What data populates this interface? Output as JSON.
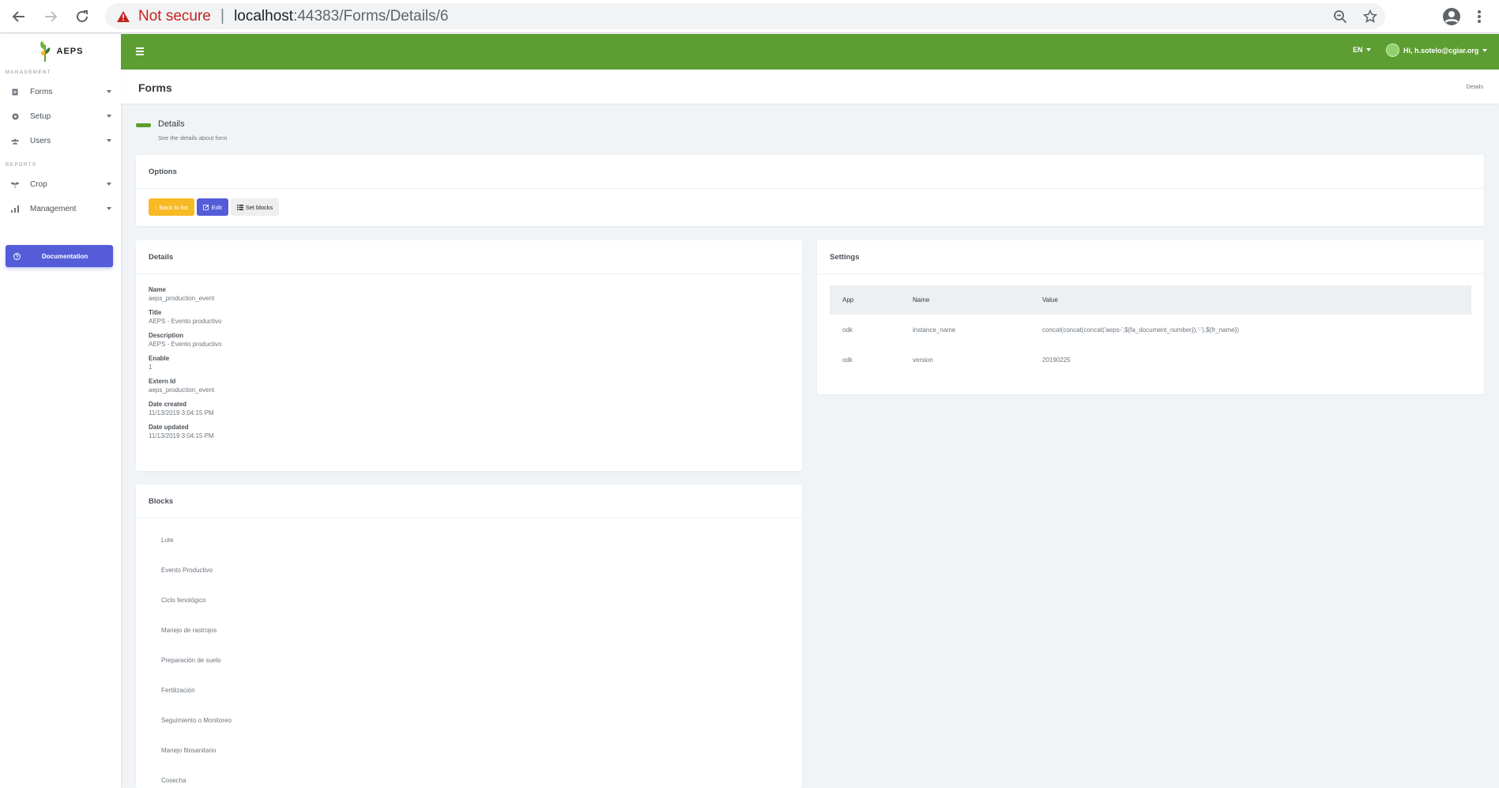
{
  "browser": {
    "security_label": "Not secure",
    "url_host": "localhost",
    "url_path": ":44383/Forms/Details/6"
  },
  "sidebar": {
    "logo_text": "AEPS",
    "management_title": "MANAGEMENT",
    "reports_title": "REPORTS",
    "management_items": [
      {
        "label": "Forms",
        "icon": "form-icon"
      },
      {
        "label": "Setup",
        "icon": "gear-icon"
      },
      {
        "label": "Users",
        "icon": "users-icon"
      }
    ],
    "report_items": [
      {
        "label": "Crop",
        "icon": "plant-icon"
      },
      {
        "label": "Management",
        "icon": "bar-chart-icon"
      }
    ],
    "documentation_label": "Documentation"
  },
  "topbar": {
    "language": "EN",
    "user_greeting": "Hi, h.sotelo@cgiar.org"
  },
  "page": {
    "title": "Forms",
    "breadcrumb": "Details",
    "section_heading": "Details",
    "section_subtitle": "See the details about form"
  },
  "options": {
    "title": "Options",
    "back_label": "Back to list",
    "edit_label": "Edit",
    "blocks_label": "Set blocks"
  },
  "details": {
    "title": "Details",
    "fields": [
      {
        "label": "Name",
        "value": "aeps_production_event"
      },
      {
        "label": "Title",
        "value": "AEPS - Evento productivo"
      },
      {
        "label": "Description",
        "value": "AEPS - Evento productivo"
      },
      {
        "label": "Enable",
        "value": "1"
      },
      {
        "label": "Extern Id",
        "value": "aeps_production_event"
      },
      {
        "label": "Date created",
        "value": "11/13/2019 3:04:15 PM"
      },
      {
        "label": "Date updated",
        "value": "11/13/2019 3:04:15 PM"
      }
    ]
  },
  "settings": {
    "title": "Settings",
    "columns": [
      "App",
      "Name",
      "Value"
    ],
    "rows": [
      [
        "odk",
        "instance_name",
        "concat(concat(concat('aeps-',${fa_document_number}),'-'),${fr_name})"
      ],
      [
        "odk",
        "version",
        "20190225"
      ]
    ]
  },
  "blocks": {
    "title": "Blocks",
    "items": [
      "Lote",
      "Evento Productivo",
      "Ciclo fenológico",
      "Manejo de rastrojos",
      "Preparación de suelo",
      "Fertilización",
      "Seguimiento o Monitoreo",
      "Manejo fitosanitario",
      "Cosecha"
    ]
  },
  "colors": {
    "brand_green": "#5d9e33",
    "primary": "#545cd8",
    "warning": "#f7b924"
  }
}
